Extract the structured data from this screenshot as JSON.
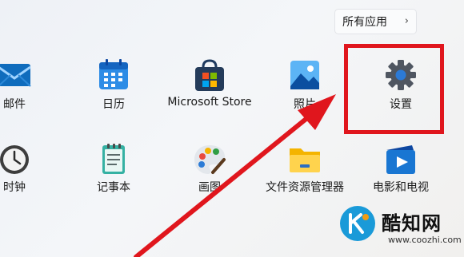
{
  "all_apps": {
    "label": "所有应用",
    "chevron": "›"
  },
  "apps_row1": [
    {
      "id": "mail",
      "label": "邮件",
      "icon": "mail-icon"
    },
    {
      "id": "calendar",
      "label": "日历",
      "icon": "calendar-icon"
    },
    {
      "id": "store",
      "label": "Microsoft Store",
      "icon": "store-icon"
    },
    {
      "id": "photos",
      "label": "照片",
      "icon": "photos-icon"
    },
    {
      "id": "settings",
      "label": "设置",
      "icon": "gear-icon"
    }
  ],
  "apps_row2": [
    {
      "id": "clock",
      "label": "时钟",
      "icon": "clock-icon"
    },
    {
      "id": "notepad",
      "label": "记事本",
      "icon": "notepad-icon"
    },
    {
      "id": "paint",
      "label": "画图",
      "icon": "palette-icon"
    },
    {
      "id": "explorer",
      "label": "文件资源管理器",
      "icon": "folder-icon"
    },
    {
      "id": "movies",
      "label": "电影和电视",
      "icon": "film-icon"
    }
  ],
  "watermark": {
    "title": "酷知网",
    "url": "www.coozhi.com"
  },
  "colors": {
    "highlight": "#e0161d",
    "accent": "#1a9ad8"
  }
}
